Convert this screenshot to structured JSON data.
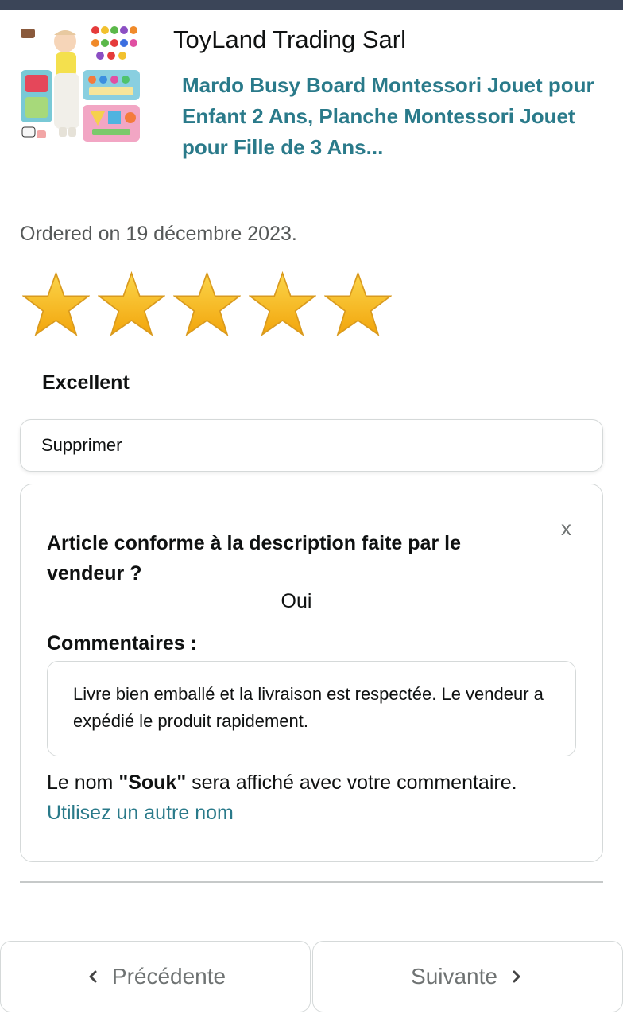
{
  "header": {
    "seller_name": "ToyLand Trading Sarl",
    "product_title": "Mardo Busy Board Montessori Jouet pour Enfant 2 Ans, Planche Montessori Jouet pour Fille de 3 Ans..."
  },
  "order": {
    "ordered_text": "Ordered on 19 décembre 2023."
  },
  "rating": {
    "stars_filled": 5,
    "stars_total": 5,
    "star_color": "#f7c21b",
    "label": "Excellent"
  },
  "actions": {
    "delete_label": "Supprimer"
  },
  "feedback": {
    "close_label": "x",
    "question": "Article conforme à la description faite par le vendeur ?",
    "answer": "Oui",
    "comments_label": "Commentaires :",
    "comment_text": "Livre bien emballé et la livraison est respectée. Le vendeur a expédié le produit rapidement.",
    "name_prefix": "Le nom ",
    "name": "\"Souk\"",
    "name_suffix": " sera affiché avec votre commentaire. ",
    "other_name_link": "Utilisez un autre nom"
  },
  "navigation": {
    "previous_label": "Précédente",
    "next_label": "Suivante"
  },
  "colors": {
    "link": "#2a7a8a",
    "top_bar": "#3b4558",
    "muted_text": "#565959"
  }
}
